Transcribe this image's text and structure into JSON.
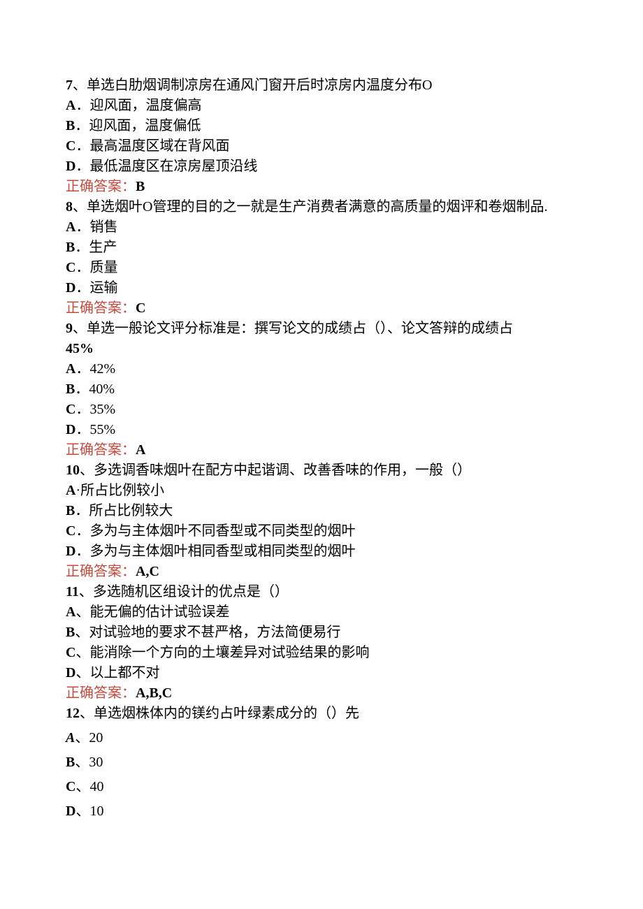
{
  "questions": [
    {
      "stem_prefix": "7",
      "stem_rest": "、单选白肋烟调制凉房在通风门窗开后时凉房内温度分布O",
      "options": [
        {
          "label": "A",
          "sep": "．",
          "text": "迎风面，温度偏高"
        },
        {
          "label": "B",
          "sep": "．",
          "text": "迎风面，温度偏低"
        },
        {
          "label": "C",
          "sep": "．",
          "text": "最高温度区域在背风面"
        },
        {
          "label": "D",
          "sep": "．",
          "text": "最低温度区在凉房屋顶沿线"
        }
      ],
      "answer_label": "正确答案：",
      "answer": "B"
    },
    {
      "stem_prefix": "8",
      "stem_rest": "、单选烟叶O管理的目的之一就是生产消费者满意的高质量的烟评和卷烟制品.",
      "options": [
        {
          "label": "A",
          "sep": "．",
          "text": "销售"
        },
        {
          "label": "B",
          "sep": "．",
          "text": "生产"
        },
        {
          "label": "C",
          "sep": "．",
          "text": "质量"
        },
        {
          "label": "D",
          "sep": "．",
          "text": "运输"
        }
      ],
      "answer_label": "正确答案：",
      "answer": "C"
    },
    {
      "stem_prefix": "9",
      "stem_rest": "、单选一般论文评分标准是：撰写论文的成绩占（）、论文答辩的成绩占",
      "stem_line2": "45%",
      "options": [
        {
          "label": "A",
          "sep": "．",
          "text": "42%"
        },
        {
          "label": "B",
          "sep": "．",
          "text": "40%"
        },
        {
          "label": "C",
          "sep": "．",
          "text": "35%"
        },
        {
          "label": "D",
          "sep": "．",
          "text": "55%"
        }
      ],
      "answer_label": "正确答案：",
      "answer": "A"
    },
    {
      "stem_prefix": "10",
      "stem_rest": "、多选调香味烟叶在配方中起谐调、改善香味的作用，一般（）",
      "options": [
        {
          "label": "A",
          "sep": "·",
          "text": "所占比例较小"
        },
        {
          "label": "B",
          "sep": "．",
          "text": "所占比例较大"
        },
        {
          "label": "C",
          "sep": "．",
          "text": "多为与主体烟叶不同香型或不同类型的烟叶"
        },
        {
          "label": "D",
          "sep": "．",
          "text": "多为与主体烟叶相同香型或相同类型的烟叶"
        }
      ],
      "answer_label": "正确答案：",
      "answer": "A,C"
    },
    {
      "stem_prefix": "11",
      "stem_rest": "、多选随机区组设计的优点是（）",
      "options": [
        {
          "label": "A",
          "sep": "、",
          "text": "能无偏的估计试验误差"
        },
        {
          "label": "B",
          "sep": "、",
          "text": "对试验地的要求不甚严格，方法简便易行"
        },
        {
          "label": "C",
          "sep": "、",
          "text": "能消除一个方向的土壤差异对试验结果的影响"
        },
        {
          "label": "D",
          "sep": "、",
          "text": "以上都不对"
        }
      ],
      "answer_label": "正确答案：",
      "answer": "A,B,C"
    },
    {
      "stem_prefix": "12",
      "stem_rest": "、单选烟株体内的镁约占叶绿素成分的（）先",
      "options": [
        {
          "label": "A",
          "sep": "、",
          "text": "20",
          "italic_label": true,
          "extra_gap": true
        },
        {
          "label": "B",
          "sep": "、",
          "text": "30",
          "extra_gap": true
        },
        {
          "label": "C",
          "sep": "、",
          "text": "40",
          "extra_gap": true
        },
        {
          "label": "D",
          "sep": "、",
          "text": "10",
          "extra_gap": true
        }
      ]
    }
  ]
}
